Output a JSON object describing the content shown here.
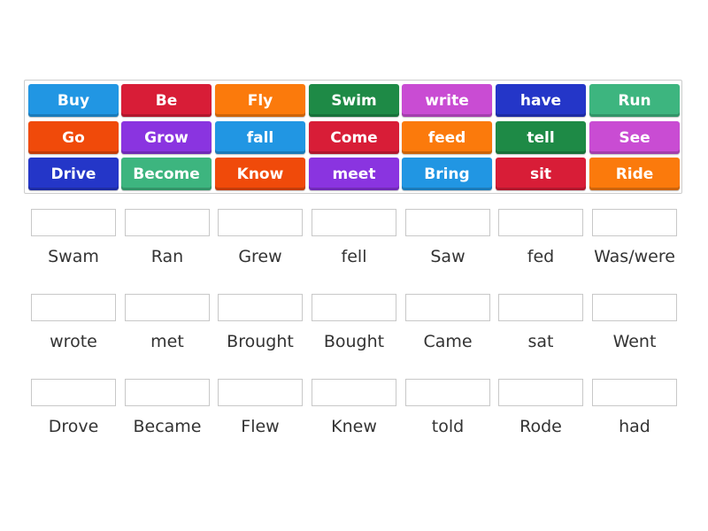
{
  "tiles": [
    [
      {
        "text": "Buy",
        "color": "#2196e3"
      },
      {
        "text": "Be",
        "color": "#d81d37"
      },
      {
        "text": "Fly",
        "color": "#fb7a0c"
      },
      {
        "text": "Swim",
        "color": "#1e8a46"
      },
      {
        "text": "write",
        "color": "#c94cd3"
      },
      {
        "text": "have",
        "color": "#2436c8"
      },
      {
        "text": "Run",
        "color": "#3db57f"
      }
    ],
    [
      {
        "text": "Go",
        "color": "#f04a0a"
      },
      {
        "text": "Grow",
        "color": "#8a34e0"
      },
      {
        "text": "fall",
        "color": "#2196e3"
      },
      {
        "text": "Come",
        "color": "#d81d37"
      },
      {
        "text": "feed",
        "color": "#fb7a0c"
      },
      {
        "text": "tell",
        "color": "#1e8a46"
      },
      {
        "text": "See",
        "color": "#c94cd3"
      }
    ],
    [
      {
        "text": "Drive",
        "color": "#2436c8"
      },
      {
        "text": "Become",
        "color": "#3db57f"
      },
      {
        "text": "Know",
        "color": "#f04a0a"
      },
      {
        "text": "meet",
        "color": "#8a34e0"
      },
      {
        "text": "Bring",
        "color": "#2196e3"
      },
      {
        "text": "sit",
        "color": "#d81d37"
      },
      {
        "text": "Ride",
        "color": "#fb7a0c"
      }
    ]
  ],
  "targets": [
    [
      "Swam",
      "Ran",
      "Grew",
      "fell",
      "Saw",
      "fed",
      "Was/were"
    ],
    [
      "wrote",
      "met",
      "Brought",
      "Bought",
      "Came",
      "sat",
      "Went"
    ],
    [
      "Drove",
      "Became",
      "Flew",
      "Knew",
      "told",
      "Rode",
      "had"
    ]
  ]
}
